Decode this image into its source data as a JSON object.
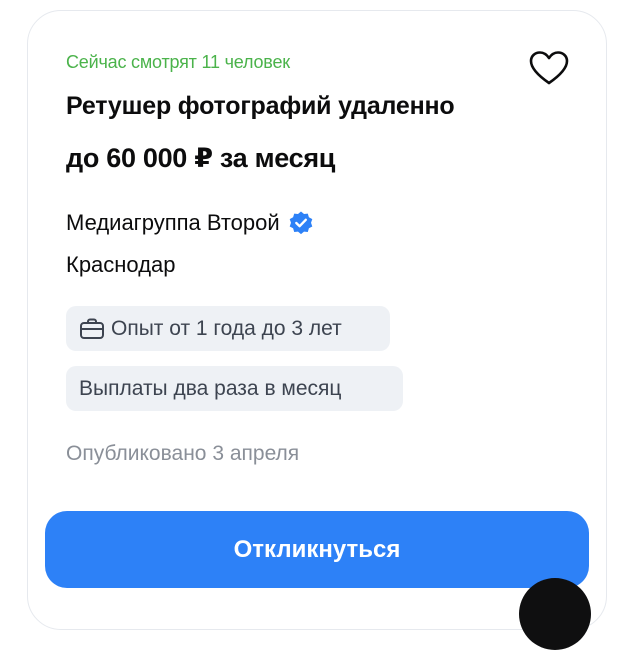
{
  "vacancy": {
    "viewers_text": "Сейчас смотрят 11 человек",
    "title": "Ретушер фотографий удаленно",
    "salary": "до 60 000 ₽ за месяц",
    "company": "Медиагруппа Второй",
    "city": "Краснодар",
    "experience": "Опыт от 1 года до 3 лет",
    "payments": "Выплаты два раза в месяц",
    "published": "Опубликовано 3 апреля",
    "respond_label": "Откликнуться"
  },
  "icons": {
    "favorite": "heart-icon",
    "verified": "verified-check-icon",
    "experience": "briefcase-icon"
  },
  "colors": {
    "viewers": "#4bb34b",
    "accent": "#2d81f7",
    "chip_bg": "#eef1f5",
    "muted": "#8a8f98"
  }
}
